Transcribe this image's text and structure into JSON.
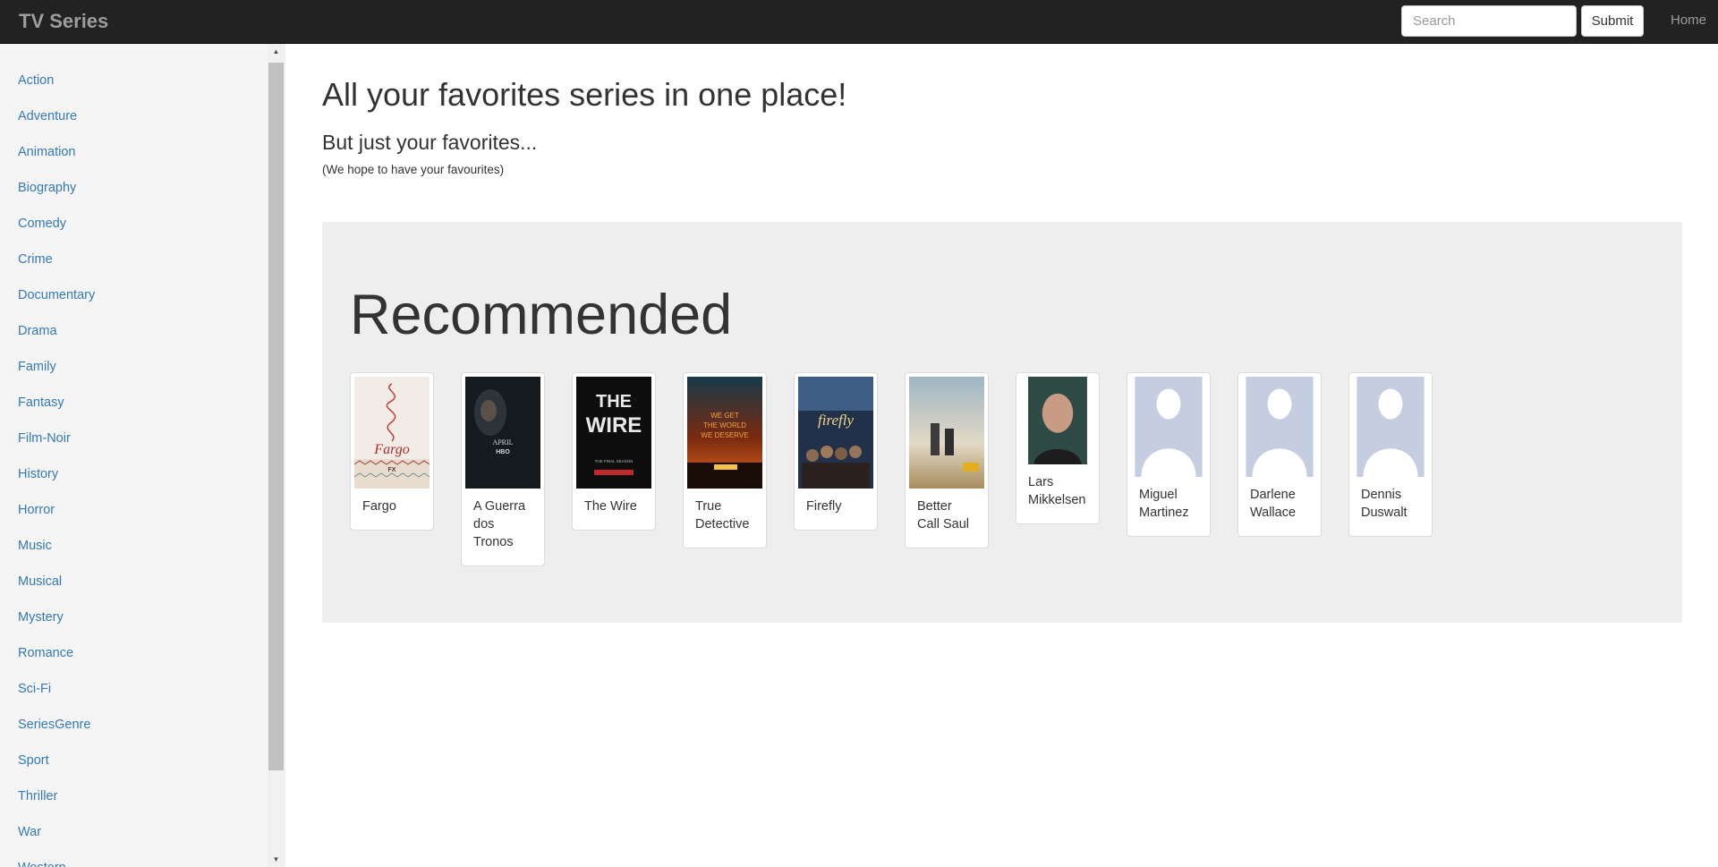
{
  "navbar": {
    "brand": "TV Series",
    "search_placeholder": "Search",
    "submit_label": "Submit",
    "home_label": "Home"
  },
  "sidebar": {
    "genres": [
      "Action",
      "Adventure",
      "Animation",
      "Biography",
      "Comedy",
      "Crime",
      "Documentary",
      "Drama",
      "Family",
      "Fantasy",
      "Film-Noir",
      "History",
      "Horror",
      "Music",
      "Musical",
      "Mystery",
      "Romance",
      "Sci-Fi",
      "SeriesGenre",
      "Sport",
      "Thriller",
      "War",
      "Western"
    ]
  },
  "main": {
    "headline": "All your favorites series in one place!",
    "subhead": "But just your favorites...",
    "note": "(We hope to have your favourites)"
  },
  "recommended": {
    "title": "Recommended",
    "items": [
      {
        "title": "Fargo",
        "poster": "fargo-poster"
      },
      {
        "title": "A Guerra dos Tronos",
        "poster": "game-of-thrones-poster",
        "poster_text": [
          "APRIL",
          "HBO"
        ]
      },
      {
        "title": "The Wire",
        "poster": "the-wire-poster",
        "poster_text": [
          "THE",
          "WIRE",
          "THE FINAL SEASON"
        ]
      },
      {
        "title": "True Detective",
        "poster": "true-detective-poster",
        "poster_text": [
          "WE GET",
          "THE WORLD",
          "WE DESERVE"
        ]
      },
      {
        "title": "Firefly",
        "poster": "firefly-poster",
        "poster_text": [
          "firefly"
        ]
      },
      {
        "title": "Better Call Saul",
        "poster": "better-call-saul-poster"
      },
      {
        "title": "Lars Mikkelsen",
        "poster": "actor-photo"
      },
      {
        "title": "Miguel Martinez",
        "poster": "placeholder-avatar"
      },
      {
        "title": "Darlene Wallace",
        "poster": "placeholder-avatar"
      },
      {
        "title": "Dennis Duswalt",
        "poster": "placeholder-avatar"
      }
    ]
  },
  "colors": {
    "navbar_bg": "#222222",
    "link": "#337ab7",
    "jumbotron_bg": "#eeeeee",
    "sidebar_bg": "#f5f5f5"
  }
}
